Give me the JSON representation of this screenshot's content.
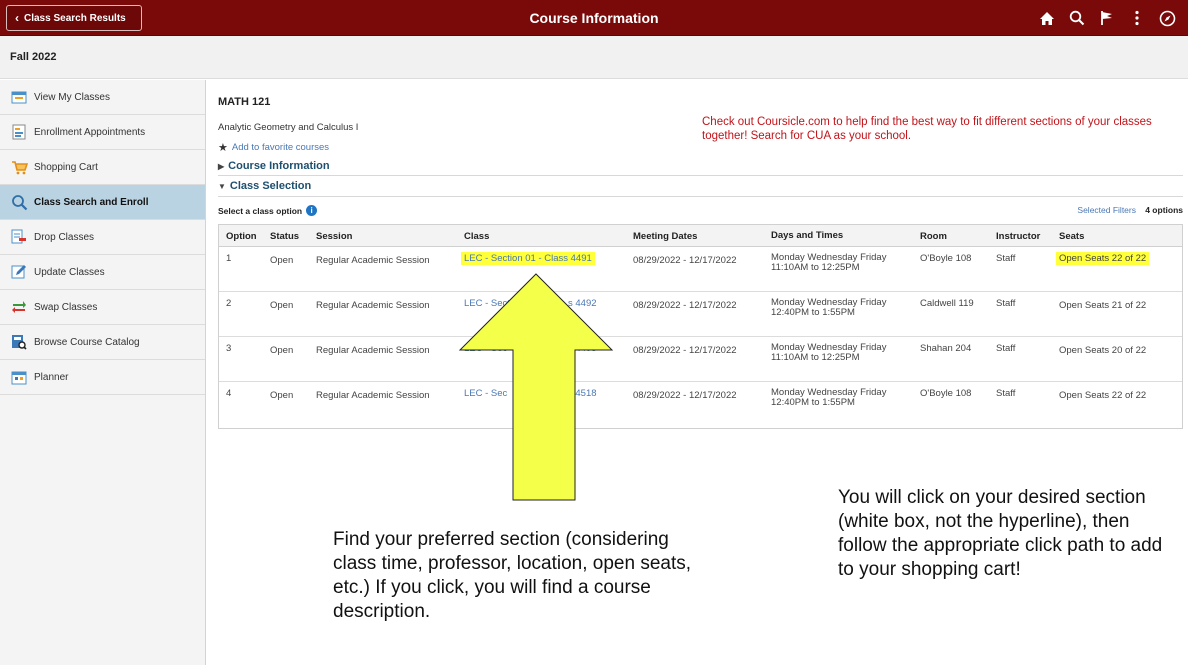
{
  "topbar": {
    "back_label": "Class Search Results",
    "title": "Course Information",
    "icons": [
      "home-icon",
      "search-icon",
      "flag-icon",
      "more-vertical-icon",
      "compass-icon"
    ]
  },
  "term": "Fall 2022",
  "sidebar": {
    "items": [
      {
        "label": "View My Classes",
        "icon": "calendar-icon"
      },
      {
        "label": "Enrollment Appointments",
        "icon": "appointment-icon"
      },
      {
        "label": "Shopping Cart",
        "icon": "cart-icon"
      },
      {
        "label": "Class Search and Enroll",
        "icon": "search-icon",
        "active": true
      },
      {
        "label": "Drop Classes",
        "icon": "drop-icon"
      },
      {
        "label": "Update Classes",
        "icon": "edit-icon"
      },
      {
        "label": "Swap Classes",
        "icon": "swap-icon"
      },
      {
        "label": "Browse Course Catalog",
        "icon": "catalog-icon"
      },
      {
        "label": "Planner",
        "icon": "planner-icon"
      }
    ]
  },
  "course": {
    "code": "MATH 121",
    "title": "Analytic Geometry and Calculus I",
    "favorite_label": "Add to favorite courses",
    "section_course_info": "Course Information",
    "section_class_selection": "Class Selection"
  },
  "promo": "Check out Coursicle.com to help find the best way to fit different sections of your classes together! Search for CUA as your school.",
  "options_bar": {
    "label": "Select a class option",
    "filters_label": "Selected Filters",
    "count": "4 options"
  },
  "table": {
    "headers": {
      "option": "Option",
      "status": "Status",
      "session": "Session",
      "class": "Class",
      "dates": "Meeting Dates",
      "days": "Days and Times",
      "room": "Room",
      "instructor": "Instructor",
      "seats": "Seats"
    },
    "rows": [
      {
        "option": "1",
        "status": "Open",
        "session": "Regular Academic Session",
        "class": "LEC - Section 01 - Class 4491",
        "dates": "08/29/2022 - 12/17/2022",
        "days1": "Monday Wednesday Friday",
        "days2": "11:10AM to 12:25PM",
        "room": "O'Boyle 108",
        "instructor": "Staff",
        "seats": "Open Seats 22 of 22"
      },
      {
        "option": "2",
        "status": "Open",
        "session": "Regular Academic Session",
        "class_left": "LEC - Secti",
        "class_right": "s 4492",
        "dates": "08/29/2022 - 12/17/2022",
        "days1": "Monday Wednesday Friday",
        "days2": "12:40PM to 1:55PM",
        "room": "Caldwell 119",
        "instructor": "Staff",
        "seats": "Open Seats 21 of 22"
      },
      {
        "option": "3",
        "status": "Open",
        "session": "Regular Academic Session",
        "class_left": "LEC - Sec",
        "class_right": "s 4493",
        "dates": "08/29/2022 - 12/17/2022",
        "days1": "Monday Wednesday Friday",
        "days2": "11:10AM to 12:25PM",
        "room": "Shahan 204",
        "instructor": "Staff",
        "seats": "Open Seats 20 of 22"
      },
      {
        "option": "4",
        "status": "Open",
        "session": "Regular Academic Session",
        "class_left": "LEC - Sec",
        "class_right": "s 4518",
        "dates": "08/29/2022 - 12/17/2022",
        "days1": "Monday Wednesday Friday",
        "days2": "12:40PM to 1:55PM",
        "room": "O'Boyle 108",
        "instructor": "Staff",
        "seats": "Open Seats 22 of 22"
      }
    ]
  },
  "annotations": {
    "left": "Find your preferred section (considering class time, professor, location, open seats, etc.) If you click, you will find a course description.",
    "right": "You will click on your desired section (white box, not the hyperline), then follow the appropriate click path to add to your shopping cart!",
    "arrow_color": "#f4ff4a",
    "highlight_color": "#ffff3a"
  },
  "colors": {
    "brand": "#7a0a0a",
    "link": "#4a78b5",
    "active_nav": "#b9d3e3",
    "promo": "#c0141a"
  }
}
